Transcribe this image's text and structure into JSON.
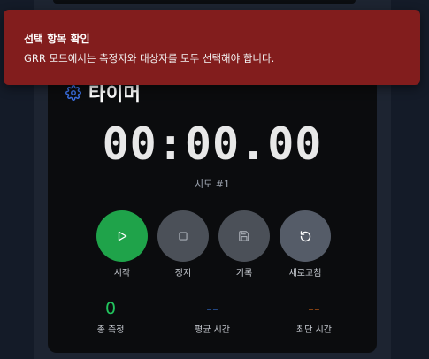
{
  "toast": {
    "title": "선택 항목 확인",
    "message": "GRR 모드에서는 측정자와 대상자를 모두 선택해야 합니다.",
    "color": "#821d1d"
  },
  "timer": {
    "title": "타이머",
    "icon": "gear-icon",
    "display": "00:00.00",
    "trial": "시도 #1"
  },
  "controls": [
    {
      "label": "시작",
      "icon": "play-icon",
      "color": "#1fa34a"
    },
    {
      "label": "정지",
      "icon": "stop-icon",
      "color": "#4b5058"
    },
    {
      "label": "기록",
      "icon": "save-icon",
      "color": "#4b5058"
    },
    {
      "label": "새로고침",
      "icon": "refresh-icon",
      "color": "#555c68"
    }
  ],
  "stats": {
    "total": {
      "value": "0",
      "label": "총 측정",
      "color": "#22c55e"
    },
    "average": {
      "value": "--",
      "label": "평균 시간",
      "color": "#3b82f6"
    },
    "shortest": {
      "value": "--",
      "label": "최단 시간",
      "color": "#f97316"
    }
  }
}
